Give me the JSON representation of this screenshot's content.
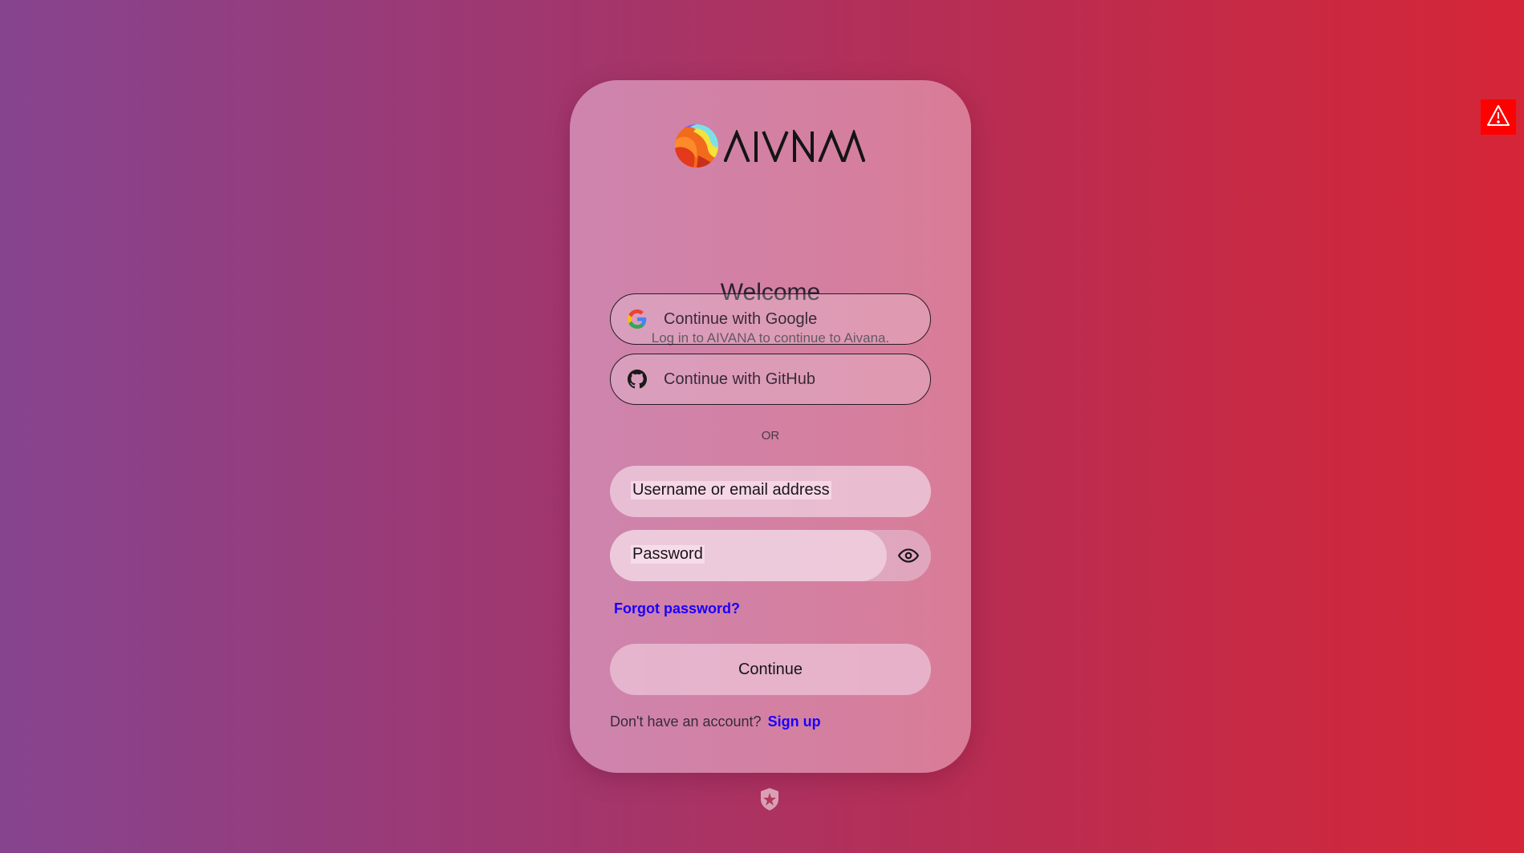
{
  "brand": {
    "name": "AIVANA"
  },
  "header": {
    "title": "Welcome",
    "subtitle": "Log in to AIVANA to continue to Aivana."
  },
  "social": {
    "google_label": "Continue with Google",
    "github_label": "Continue with GitHub"
  },
  "divider": {
    "label": "OR"
  },
  "form": {
    "username_placeholder": "Username or email address",
    "password_placeholder": "Password",
    "forgot_label": "Forgot password?",
    "submit_label": "Continue"
  },
  "footer": {
    "prompt": "Don't have an account?",
    "signup_label": "Sign up"
  },
  "icons": {
    "google": "google-icon",
    "github": "github-icon",
    "eye": "eye-icon",
    "shield": "auth0-shield-icon",
    "warning": "warning-icon"
  },
  "colors": {
    "link": "#1a00ff",
    "warning_bg": "#ff0000",
    "bg_left": "#86448f",
    "bg_right": "#d52637"
  }
}
